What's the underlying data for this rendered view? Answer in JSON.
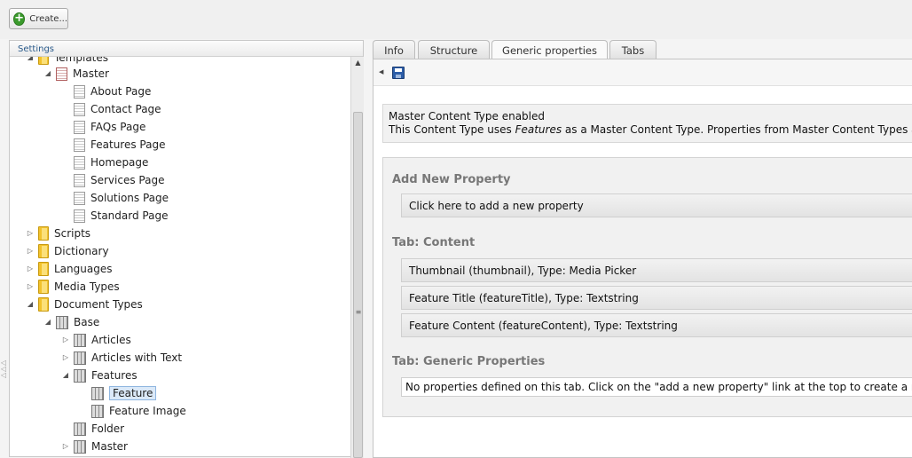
{
  "toolbar": {
    "create_label": "Create..."
  },
  "left_panel": {
    "header": "Settings",
    "tree": [
      {
        "label": "Templates",
        "icon": "folder",
        "level": 1,
        "arrow": "expanded",
        "partial": true
      },
      {
        "label": "Master",
        "icon": "master",
        "level": 2,
        "arrow": "expanded"
      },
      {
        "label": "About Page",
        "icon": "doc",
        "level": 3,
        "arrow": "none"
      },
      {
        "label": "Contact Page",
        "icon": "doc",
        "level": 3,
        "arrow": "none"
      },
      {
        "label": "FAQs Page",
        "icon": "doc",
        "level": 3,
        "arrow": "none"
      },
      {
        "label": "Features Page",
        "icon": "doc",
        "level": 3,
        "arrow": "none"
      },
      {
        "label": "Homepage",
        "icon": "doc",
        "level": 3,
        "arrow": "none"
      },
      {
        "label": "Services Page",
        "icon": "doc",
        "level": 3,
        "arrow": "none"
      },
      {
        "label": "Solutions Page",
        "icon": "doc",
        "level": 3,
        "arrow": "none"
      },
      {
        "label": "Standard Page",
        "icon": "doc",
        "level": 3,
        "arrow": "none"
      },
      {
        "label": "Scripts",
        "icon": "folder",
        "level": 1,
        "arrow": "collapsed"
      },
      {
        "label": "Dictionary",
        "icon": "folder",
        "level": 1,
        "arrow": "collapsed"
      },
      {
        "label": "Languages",
        "icon": "folder",
        "level": 1,
        "arrow": "collapsed"
      },
      {
        "label": "Media Types",
        "icon": "folder",
        "level": 1,
        "arrow": "collapsed"
      },
      {
        "label": "Document Types",
        "icon": "folder",
        "level": 1,
        "arrow": "expanded"
      },
      {
        "label": "Base",
        "icon": "dtype",
        "level": 2,
        "arrow": "expanded"
      },
      {
        "label": "Articles",
        "icon": "dtype",
        "level": 3,
        "arrow": "collapsed"
      },
      {
        "label": "Articles with Text",
        "icon": "dtype",
        "level": 3,
        "arrow": "collapsed"
      },
      {
        "label": "Features",
        "icon": "dtype",
        "level": 3,
        "arrow": "expanded"
      },
      {
        "label": "Feature",
        "icon": "dtype",
        "level": 4,
        "arrow": "none",
        "selected": true
      },
      {
        "label": "Feature Image",
        "icon": "dtype",
        "level": 4,
        "arrow": "none"
      },
      {
        "label": "Folder",
        "icon": "dtype",
        "level": 3,
        "arrow": "none"
      },
      {
        "label": "Master",
        "icon": "dtype",
        "level": 3,
        "arrow": "collapsed"
      }
    ]
  },
  "tabs": [
    {
      "label": "Info",
      "active": false
    },
    {
      "label": "Structure",
      "active": false
    },
    {
      "label": "Generic properties",
      "active": true
    },
    {
      "label": "Tabs",
      "active": false
    }
  ],
  "master_notice": {
    "title": "Master Content Type enabled",
    "text_before": "This Content Type uses ",
    "master_name": "Features",
    "text_after": " as a Master Content Type. Properties from Master Content Types are not"
  },
  "add_property": {
    "title": "Add New Property",
    "link": "Click here to add a new property"
  },
  "tab_content": {
    "title": "Tab: Content",
    "properties": [
      "Thumbnail (thumbnail), Type: Media Picker",
      "Feature Title (featureTitle), Type: Textstring",
      "Feature Content (featureContent), Type: Textstring"
    ]
  },
  "tab_generic": {
    "title": "Tab: Generic Properties",
    "empty_message": "No properties defined on this tab. Click on the \"add a new property\" link at the top to create a new p"
  }
}
